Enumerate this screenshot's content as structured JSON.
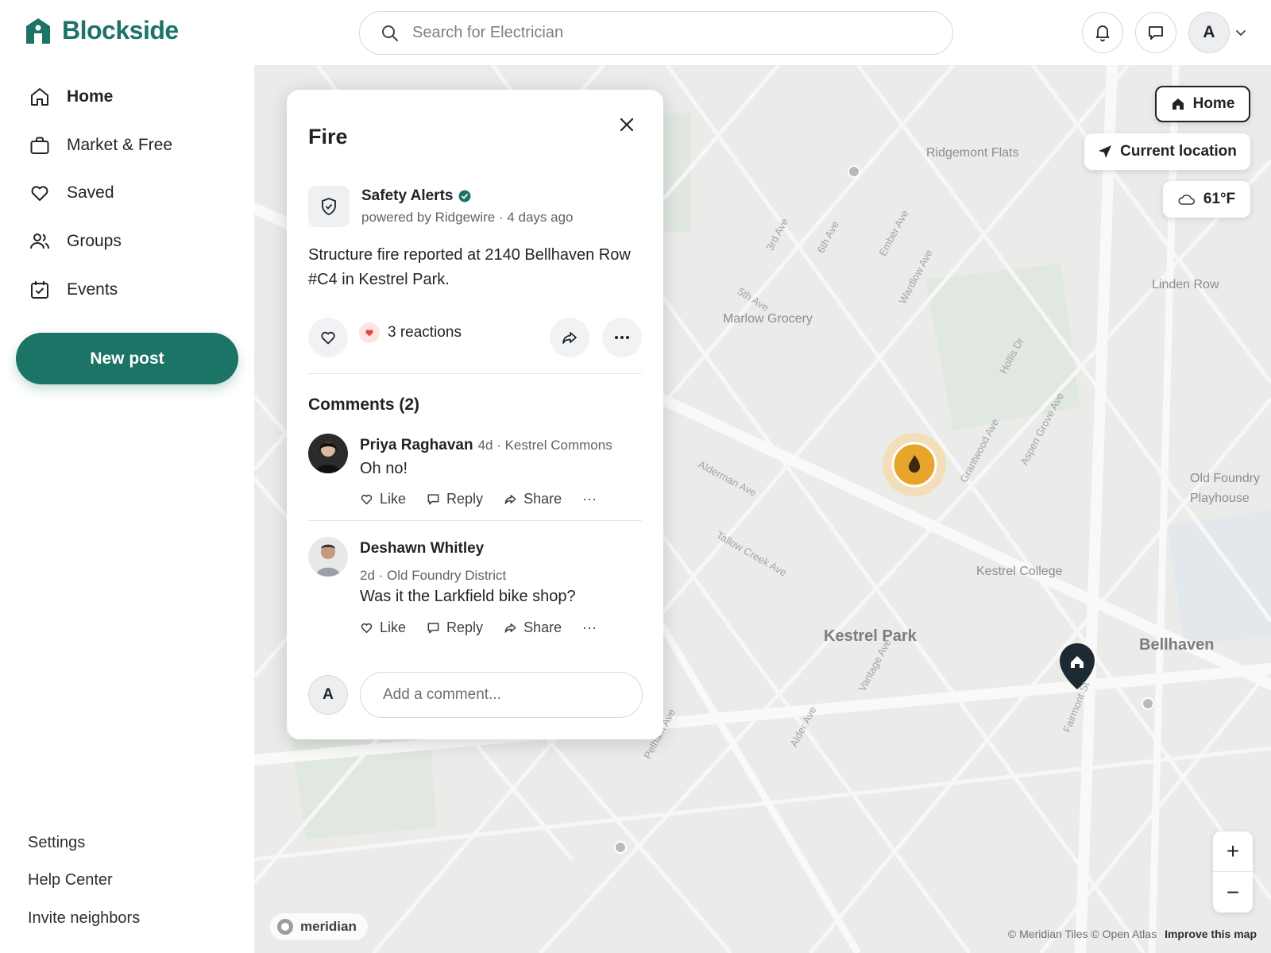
{
  "brand": {
    "name": "Blockside",
    "color": "#1b7466"
  },
  "search": {
    "placeholder": "Search for Electrician"
  },
  "header": {
    "avatar_initial": "A"
  },
  "sidebar": {
    "items": [
      {
        "label": "Home",
        "icon": "home-icon"
      },
      {
        "label": "Market & Free",
        "icon": "shopping-bag-icon"
      },
      {
        "label": "Saved",
        "icon": "heart-icon"
      },
      {
        "label": "Groups",
        "icon": "people-icon"
      },
      {
        "label": "Events",
        "icon": "calendar-check-icon"
      }
    ],
    "new_post": "New post",
    "footer": [
      "Settings",
      "Help Center",
      "Invite neighbors"
    ]
  },
  "map": {
    "home_button": "Home",
    "current_location": "Current location",
    "weather": "61°F",
    "labels": {
      "ridgemont": "Ridgemont Flats",
      "linden": "Linden Row",
      "marlow": "Marlow Grocery",
      "foundry1": "Old Foundry",
      "foundry2": "Playhouse",
      "college": "Kestrel College",
      "park": "Kestrel Park",
      "bellhaven": "Bellhaven"
    },
    "streets": {
      "s3rd": "3rd Ave",
      "s6th": "6th Ave",
      "ember": "Ember Ave",
      "wardlow": "Wardlow Ave",
      "s5th": "5th Ave",
      "hollis": "Hollis Dr",
      "grantwood": "Grantwood Ave",
      "aspen": "Aspen Grove Ave",
      "alderman": "Alderman Ave",
      "tallow": "Tallow Creek Ave",
      "vantage": "Vantage Ave",
      "alder": "Alder Ave",
      "pelham": "Pelham Ave",
      "fairmont": "Fairmont St"
    },
    "logo": "meridian",
    "attribution": "© Meridian Tiles © Open Atlas",
    "improve": "Improve this map"
  },
  "post": {
    "title": "Fire",
    "source": "Safety Alerts",
    "source_meta": "powered by Ridgewire · 4 days ago",
    "body": "Structure fire reported at 2140 Bellhaven Row #C4 in Kestrel Park.",
    "reactions": "3 reactions",
    "comments_title": "Comments (2)",
    "comments": [
      {
        "name": "Priya Raghavan",
        "meta": "4d · Kestrel Commons",
        "text": "Oh no!"
      },
      {
        "name": "Deshawn Whitley",
        "meta": "2d · Old Foundry District",
        "text": "Was it the Larkfield bike shop?"
      }
    ],
    "actions": {
      "like": "Like",
      "reply": "Reply",
      "share": "Share",
      "more": "···"
    },
    "my_initial": "A",
    "comment_placeholder": "Add a comment..."
  }
}
